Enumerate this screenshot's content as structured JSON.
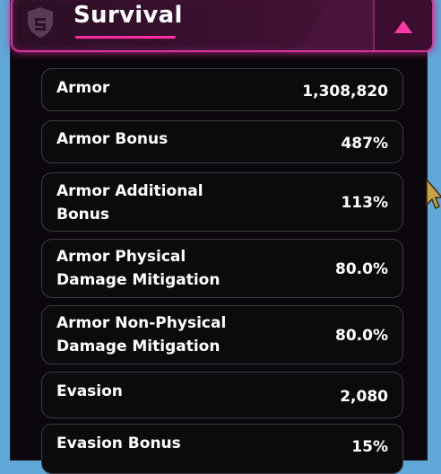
{
  "header": {
    "title": "Survival",
    "icon": "shield-icon",
    "toggle_icon": "collapse-arrow-icon",
    "accent": "#ff2c9e"
  },
  "stats": [
    {
      "label": "Armor",
      "value": "1,308,820"
    },
    {
      "label": "Armor Bonus",
      "value": "487%"
    },
    {
      "label": "Armor Additional Bonus",
      "value": "113%"
    },
    {
      "label": "Armor Physical Damage Mitigation",
      "value": "80.0%"
    },
    {
      "label": "Armor Non-Physical Damage Mitigation",
      "value": "80.0%"
    },
    {
      "label": "Evasion",
      "value": "2,080"
    },
    {
      "label": "Evasion Bonus",
      "value": "15%"
    }
  ]
}
